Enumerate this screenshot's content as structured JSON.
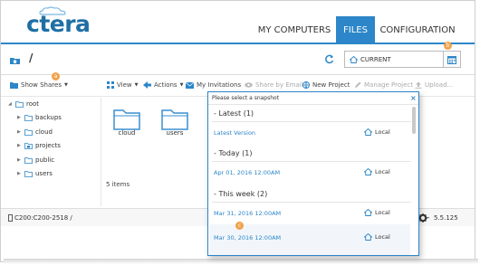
{
  "header": {
    "logo_text": "ctera",
    "nav": [
      {
        "label": "MY COMPUTERS",
        "active": false
      },
      {
        "label": "FILES",
        "active": true
      },
      {
        "label": "CONFIGURATION",
        "active": false
      }
    ]
  },
  "pathbar": {
    "path": "/",
    "snapshot_value": "CURRENT",
    "badge_b": "b"
  },
  "toolbar": {
    "show_shares": "Show Shares",
    "badge_a": "a",
    "view": "View",
    "actions": "Actions",
    "my_invitations": "My Invitations",
    "share_by_email": "Share by Email",
    "new_project": "New Project",
    "manage_project": "Manage Project",
    "upload": "Upload..."
  },
  "tree": {
    "root": "root",
    "items": [
      "backups",
      "cloud",
      "projects",
      "public",
      "users"
    ]
  },
  "main": {
    "folders": [
      "cloud",
      "users"
    ],
    "items_count": "5 items"
  },
  "statusbar": {
    "device": "C200:C200-2518 /",
    "version": "5.5.125"
  },
  "snapshot_dropdown": {
    "header": "Please select a snapshot",
    "close": "×",
    "sections": [
      {
        "title": "Latest (1)",
        "entries": [
          {
            "label": "Latest Version",
            "location": "Local"
          }
        ]
      },
      {
        "title": "Today (1)",
        "entries": [
          {
            "label": "Apr 01, 2016 12:00AM",
            "location": "Local"
          }
        ]
      },
      {
        "title": "This week (2)",
        "entries": [
          {
            "label": "Mar 31, 2016 12:00AM",
            "location": "Local"
          },
          {
            "label": "Mar 30, 2016 12:00AM",
            "location": "Local"
          }
        ]
      }
    ],
    "badge_c": "c"
  },
  "colors": {
    "accent": "#2c86c9",
    "logo": "#1f6fa5",
    "badge": "#f0a24a",
    "folder": "#3a8fd0"
  }
}
